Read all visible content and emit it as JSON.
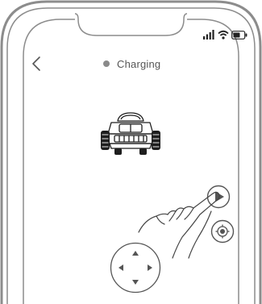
{
  "status": {
    "label": "Charging",
    "dot_color": "#8a8a8a"
  },
  "icons": {
    "back": "chevron-left-icon",
    "signal": "cellular-signal-icon",
    "wifi": "wifi-icon",
    "battery": "battery-icon",
    "mower": "robot-mower-icon",
    "play": "play-icon",
    "locate": "locate-target-icon",
    "gesture": "hand-tap-icon",
    "dpad": "direction-pad-icon"
  },
  "colors": {
    "frame": "#8c8c8c",
    "line": "#4a4a4a",
    "text": "#555555"
  }
}
